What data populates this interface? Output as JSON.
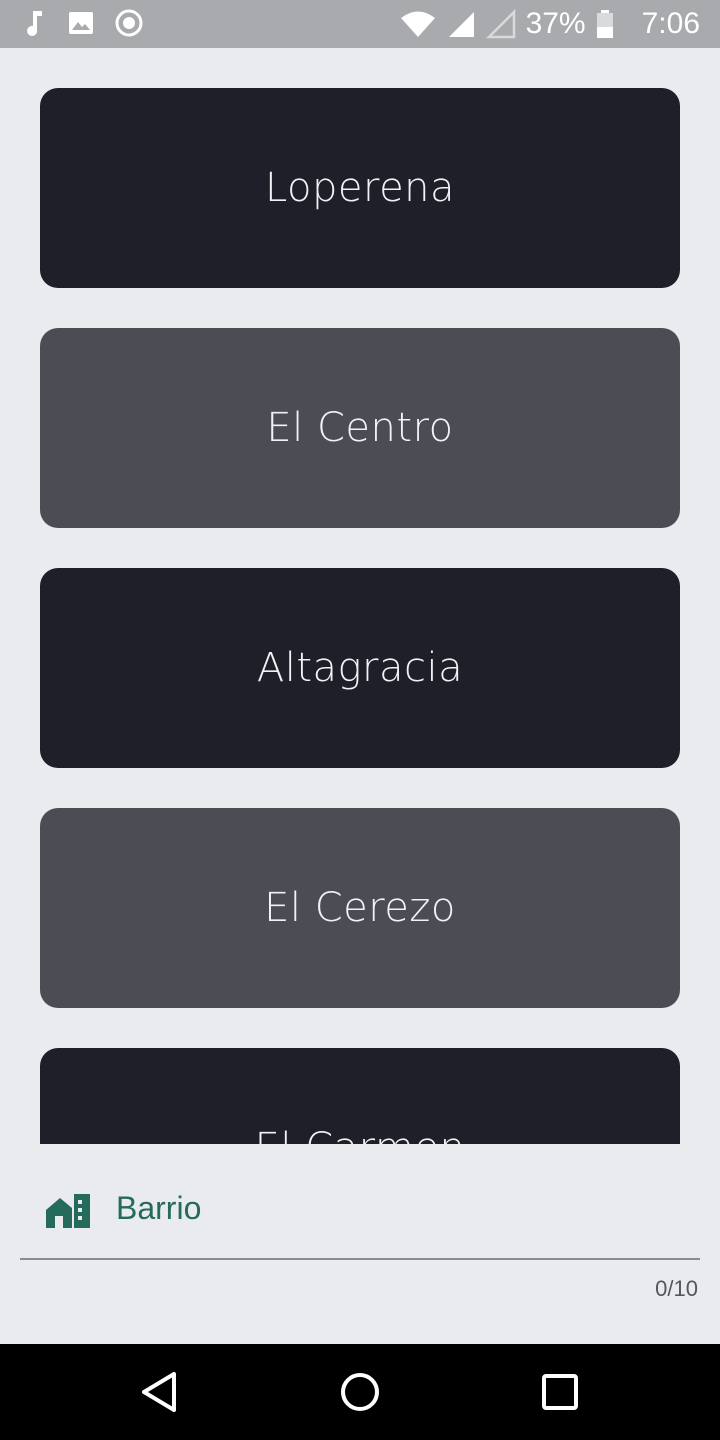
{
  "status_bar": {
    "battery": "37%",
    "time": "7:06",
    "icons_left": [
      "music-note-icon",
      "image-icon",
      "record-icon"
    ],
    "icons_right": [
      "wifi-icon",
      "signal-icon",
      "signal-empty-icon",
      "battery-icon"
    ]
  },
  "list": {
    "items": [
      {
        "label": "Loperena",
        "color": "#1e1f28"
      },
      {
        "label": "El Centro",
        "color": "#4b4c54"
      },
      {
        "label": "Altagracia",
        "color": "#1e1f28"
      },
      {
        "label": "El Cerezo",
        "color": "#4b4c54"
      },
      {
        "label": "El Carmen",
        "color": "#1e1f28"
      }
    ]
  },
  "input": {
    "icon": "home-building-icon",
    "label": "Barrio",
    "counter": "0/10",
    "accent_color": "#256b5b"
  },
  "nav_bar": {
    "buttons": [
      "back-icon",
      "home-icon",
      "recents-icon"
    ]
  }
}
